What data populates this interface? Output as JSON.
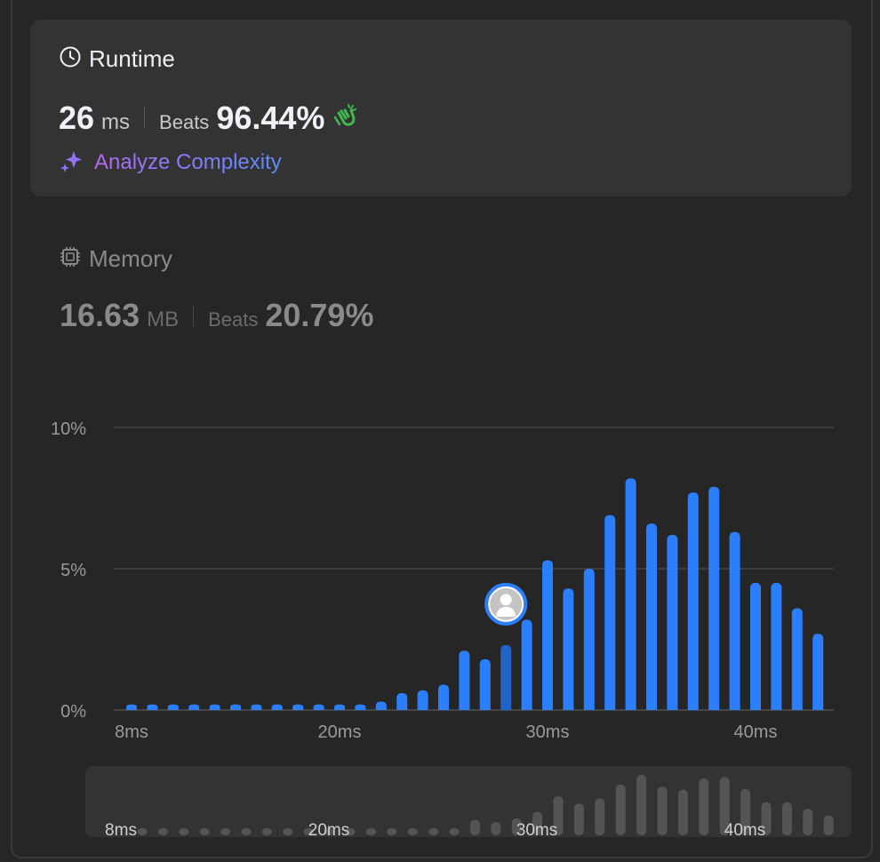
{
  "runtime": {
    "title": "Runtime",
    "value": "26",
    "unit": "ms",
    "beats_label": "Beats",
    "beats_value": "96.44%",
    "analyze_label": "Analyze Complexity"
  },
  "memory": {
    "title": "Memory",
    "value": "16.63",
    "unit": "MB",
    "beats_label": "Beats",
    "beats_value": "20.79%"
  },
  "colors": {
    "bar": "#2b7fff",
    "bar_selected": "#1f63c8",
    "gridline": "#4a4a4a",
    "navigator_bar": "#545454",
    "clap_icon": "#3fb950"
  },
  "chart_data": {
    "type": "bar",
    "x": [
      8,
      9,
      10,
      11,
      12,
      13,
      14,
      15,
      16,
      17,
      18,
      19,
      20,
      21,
      22,
      23,
      24,
      25,
      26,
      27,
      28,
      29,
      30,
      31,
      32,
      33,
      34,
      35,
      36,
      37,
      38,
      39,
      40,
      41,
      42,
      43
    ],
    "values": [
      0.2,
      0.2,
      0.2,
      0.2,
      0.2,
      0.2,
      0.2,
      0.2,
      0.2,
      0.2,
      0.2,
      0.2,
      0.3,
      0.6,
      0.7,
      0.9,
      2.1,
      1.8,
      2.3,
      3.2,
      5.3,
      4.3,
      5.0,
      6.9,
      8.2,
      6.6,
      6.2,
      7.7,
      7.9,
      6.3,
      4.5,
      4.5,
      3.6,
      2.7
    ],
    "selected_x": 26,
    "ylim": [
      0,
      10
    ],
    "y_ticks": [
      "0%",
      "5%",
      "10%"
    ],
    "y_tick_values": [
      0,
      5,
      10
    ],
    "x_ticks": [
      "8ms",
      "20ms",
      "30ms",
      "40ms"
    ],
    "x_tick_values": [
      8,
      18,
      28,
      38
    ],
    "xlabel": "",
    "ylabel": "",
    "grid": true,
    "navigator_ticks": [
      "8ms",
      "20ms",
      "30ms",
      "40ms"
    ]
  }
}
